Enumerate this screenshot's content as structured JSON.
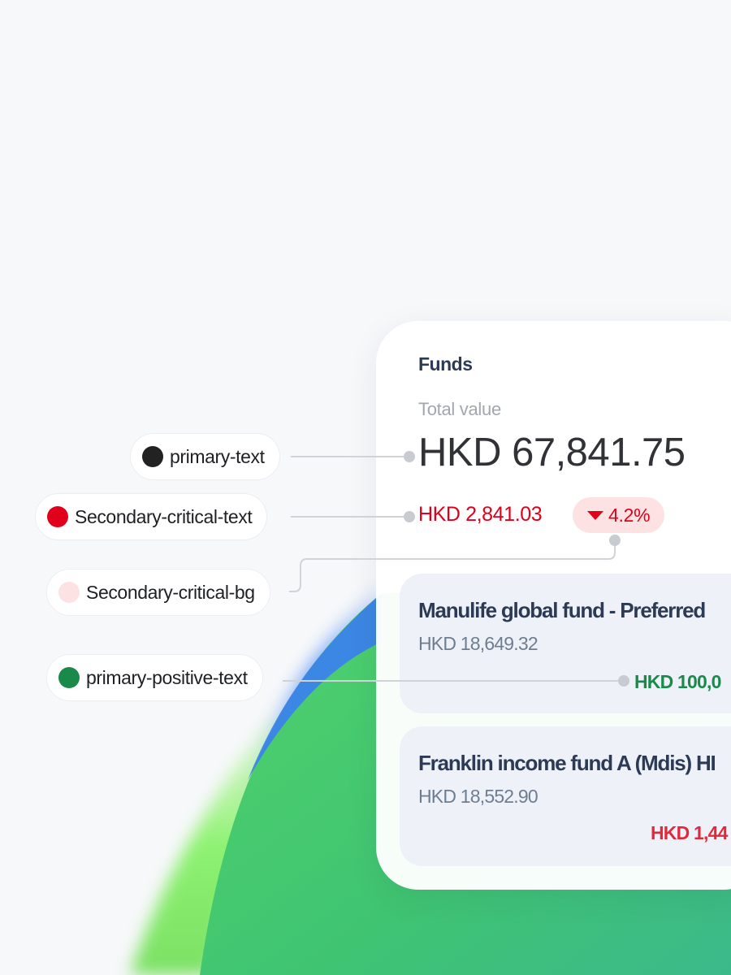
{
  "tokens": [
    {
      "label": "primary-text",
      "color": "#222222"
    },
    {
      "label": "Secondary-critical-text",
      "color": "#e0001b"
    },
    {
      "label": "Secondary-critical-bg",
      "color": "#fde2e4"
    },
    {
      "label": "primary-positive-text",
      "color": "#1a8a4a"
    }
  ],
  "card": {
    "title": "Funds",
    "total_label": "Total value",
    "total_value": "HKD 67,841.75",
    "change_amount": "HKD 2,841.03",
    "change_percent": "4.2%",
    "change_icon": "caret-down-icon"
  },
  "funds": [
    {
      "name": "Manulife global fund - Preferred",
      "value": "HKD 18,649.32",
      "return": "HKD 100,0"
    },
    {
      "name": "Franklin income fund A (Mdis) HI",
      "value": "HKD 18,552.90",
      "return": "HKD 1,44"
    }
  ],
  "colors": {
    "background": "#f7f8fa",
    "card_background": "#ffffff",
    "fund_card_background": "#eef2f8",
    "heading": "#2c3a55",
    "critical": "#e0001b",
    "critical_bg": "#fde2e4",
    "positive": "#1a8a4a",
    "accent_blue": "#3b7ff0",
    "accent_green": "#45c96e"
  }
}
